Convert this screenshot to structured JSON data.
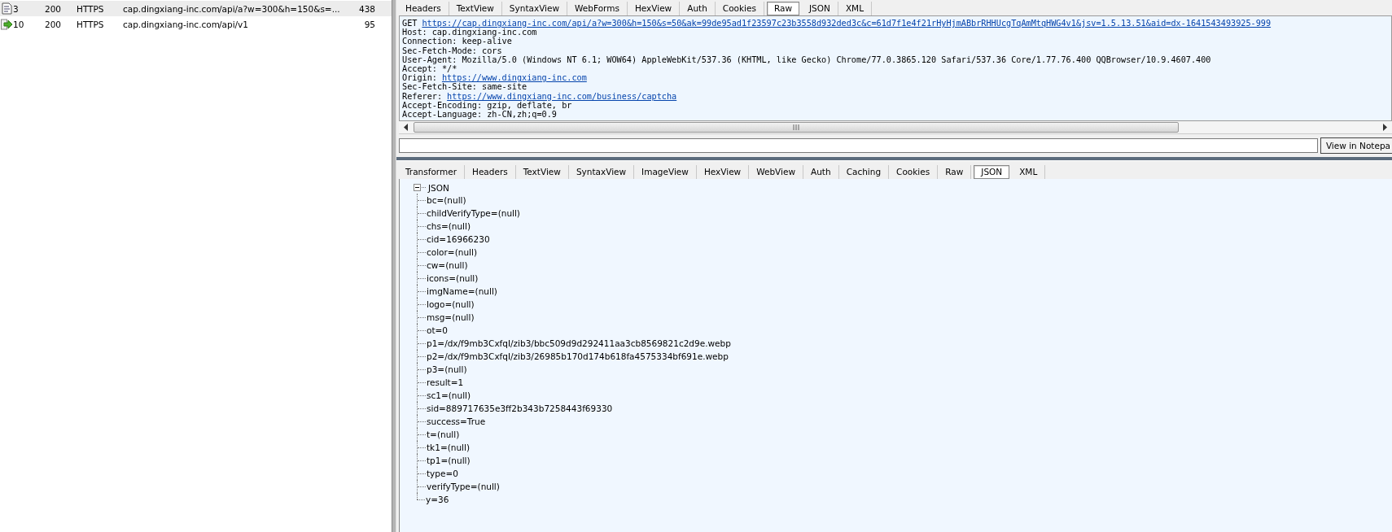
{
  "sessions": [
    {
      "number": "3",
      "result": "200",
      "protocol": "HTTPS",
      "host": "cap.dingxiang-inc.com",
      "url": "/api/a?w=300&h=150&s=...",
      "body": "438",
      "kind": "json",
      "selected": true
    },
    {
      "number": "10",
      "result": "200",
      "protocol": "HTTPS",
      "host": "cap.dingxiang-inc.com",
      "url": "/api/v1",
      "body": "95",
      "kind": "request",
      "selected": false
    }
  ],
  "request_tabs": [
    {
      "label": "Headers",
      "selected": false
    },
    {
      "label": "TextView",
      "selected": false
    },
    {
      "label": "SyntaxView",
      "selected": false
    },
    {
      "label": "WebForms",
      "selected": false
    },
    {
      "label": "HexView",
      "selected": false
    },
    {
      "label": "Auth",
      "selected": false
    },
    {
      "label": "Cookies",
      "selected": false
    },
    {
      "label": "Raw",
      "selected": true
    },
    {
      "label": "JSON",
      "selected": false
    },
    {
      "label": "XML",
      "selected": false
    }
  ],
  "raw_request": [
    {
      "label": "GET",
      "value": "https://cap.dingxiang-inc.com/api/a?w=300&h=150&s=50&ak=99de95ad1f23597c23b3558d932ded3c&c=61d7f1e4f21rHyHjmABbrRHHUcgTqAmMtqHWG4v1&jsv=1.5.13.51&aid=dx-1641543493925-999",
      "link": true
    },
    {
      "label": "Host:",
      "value": "cap.dingxiang-inc.com",
      "link": false
    },
    {
      "label": "Connection:",
      "value": "keep-alive",
      "link": false
    },
    {
      "label": "Sec-Fetch-Mode:",
      "value": "cors",
      "link": false
    },
    {
      "label": "User-Agent:",
      "value": "Mozilla/5.0 (Windows NT 6.1; WOW64) AppleWebKit/537.36 (KHTML, like Gecko) Chrome/77.0.3865.120 Safari/537.36 Core/1.77.76.400 QQBrowser/10.9.4607.400",
      "link": false
    },
    {
      "label": "Accept:",
      "value": "*/*",
      "link": false
    },
    {
      "label": "Origin:",
      "value": "https://www.dingxiang-inc.com",
      "link": true
    },
    {
      "label": "Sec-Fetch-Site:",
      "value": "same-site",
      "link": false
    },
    {
      "label": "Referer:",
      "value": "https://www.dingxiang-inc.com/business/captcha",
      "link": true
    },
    {
      "label": "Accept-Encoding:",
      "value": "gzip, deflate, br",
      "link": false
    },
    {
      "label": "Accept-Language:",
      "value": "zh-CN,zh;q=0.9",
      "link": false
    }
  ],
  "notepad_button": "View in Notepa",
  "response_tabs": [
    {
      "label": "Transformer",
      "selected": false
    },
    {
      "label": "Headers",
      "selected": false
    },
    {
      "label": "TextView",
      "selected": false
    },
    {
      "label": "SyntaxView",
      "selected": false
    },
    {
      "label": "ImageView",
      "selected": false
    },
    {
      "label": "HexView",
      "selected": false
    },
    {
      "label": "WebView",
      "selected": false
    },
    {
      "label": "Auth",
      "selected": false
    },
    {
      "label": "Caching",
      "selected": false
    },
    {
      "label": "Cookies",
      "selected": false
    },
    {
      "label": "Raw",
      "selected": false
    },
    {
      "label": "JSON",
      "selected": true
    },
    {
      "label": "XML",
      "selected": false
    }
  ],
  "json_tree": {
    "label": "JSON",
    "expanded": true,
    "children": [
      {
        "label": "bc=(null)"
      },
      {
        "label": "childVerifyType=(null)"
      },
      {
        "label": "chs=(null)"
      },
      {
        "label": "cid=16966230"
      },
      {
        "label": "color=(null)"
      },
      {
        "label": "cw=(null)"
      },
      {
        "label": "icons=(null)"
      },
      {
        "label": "imgName=(null)"
      },
      {
        "label": "logo=(null)"
      },
      {
        "label": "msg=(null)"
      },
      {
        "label": "ot=0"
      },
      {
        "label": "p1=/dx/f9mb3CxfqI/zib3/bbc509d9d292411aa3cb8569821c2d9e.webp"
      },
      {
        "label": "p2=/dx/f9mb3CxfqI/zib3/26985b170d174b618fa4575334bf691e.webp"
      },
      {
        "label": "p3=(null)"
      },
      {
        "label": "result=1"
      },
      {
        "label": "sc1=(null)"
      },
      {
        "label": "sid=889717635e3ff2b343b7258443f69330"
      },
      {
        "label": "success=True"
      },
      {
        "label": "t=(null)"
      },
      {
        "label": "tk1=(null)"
      },
      {
        "label": "tp1=(null)"
      },
      {
        "label": "type=0"
      },
      {
        "label": "verifyType=(null)"
      },
      {
        "label": "y=36"
      }
    ]
  }
}
